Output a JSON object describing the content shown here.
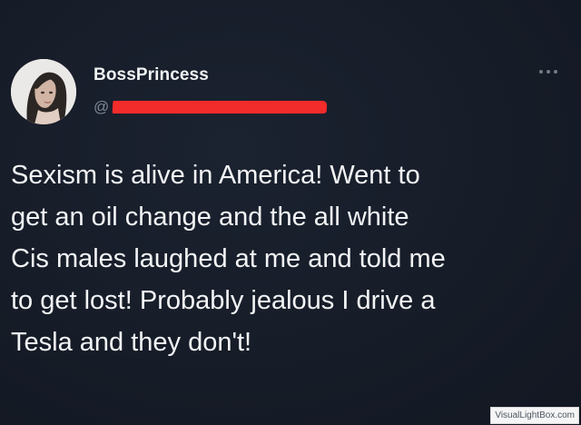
{
  "tweet": {
    "author": {
      "display_name": "BossPrincess",
      "handle_prefix": "@"
    },
    "text": "Sexism is alive in America! Went to\nget an oil change and the all white\nCis males laughed at me and told me\nto get lost! Probably jealous I drive a\nTesla and they don't!",
    "menu_icon": "more-horizontal-icon"
  },
  "watermark": {
    "text": "VisualLightBox.com"
  },
  "colors": {
    "background": "#151b26",
    "text": "#f3f4f6",
    "secondary_text": "#7d8794",
    "redaction": "#f22b2b"
  }
}
